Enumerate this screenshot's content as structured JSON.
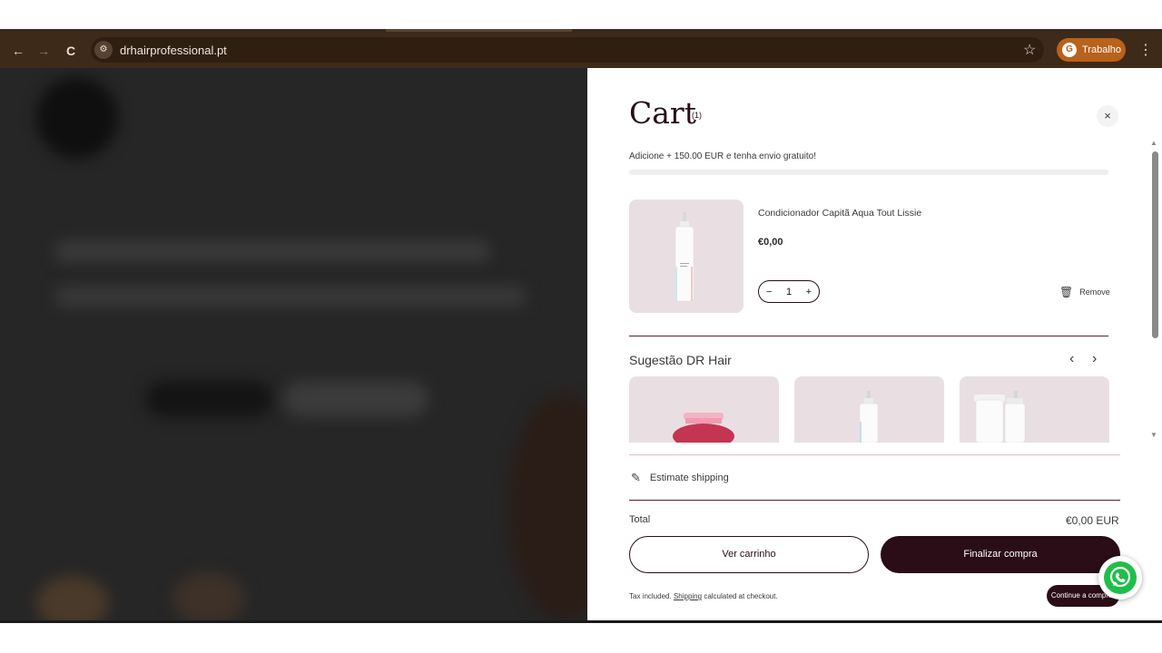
{
  "browser": {
    "url": "drhairprofessional.pt",
    "profile_initial": "G",
    "profile_label": "Trabalho",
    "back_glyph": "←",
    "forward_glyph": "→",
    "reload_glyph": "C",
    "site_info_glyph": "⚙",
    "star_glyph": "☆",
    "menu_glyph": "⋮"
  },
  "cart": {
    "title": "Cart",
    "count": "(1)",
    "close_glyph": "×",
    "free_shipping": "Adicione + 150.00 EUR e tenha envio gratuito!",
    "free_shipping_progress": 0,
    "item": {
      "name": "Condicionador Capitã Aqua Tout Lissie",
      "price": "€0,00",
      "minus": "−",
      "quantity": "1",
      "plus": "+",
      "remove_label": "Remove",
      "trash_glyph": "🗑"
    },
    "suggestions": {
      "title": "Sugestão DR Hair",
      "prev_glyph": "‹",
      "next_glyph": "›"
    },
    "estimate_shipping": "Estimate shipping",
    "pencil_glyph": "✎",
    "total_label": "Total",
    "total_value": "€0,00 EUR",
    "view_cart": "Ver carrinho",
    "checkout": "Finalizar compra",
    "tax_prefix": "Tax included.",
    "tax_link": "Shipping",
    "tax_suffix": "calculated at checkout.",
    "continue_shopping": "Continue a comprar"
  },
  "colors": {
    "brand_dark": "#2a0d16",
    "browser_toolbar": "#3e2a18",
    "profile_chip": "#b8621b",
    "whatsapp": "#1fbe4b"
  }
}
